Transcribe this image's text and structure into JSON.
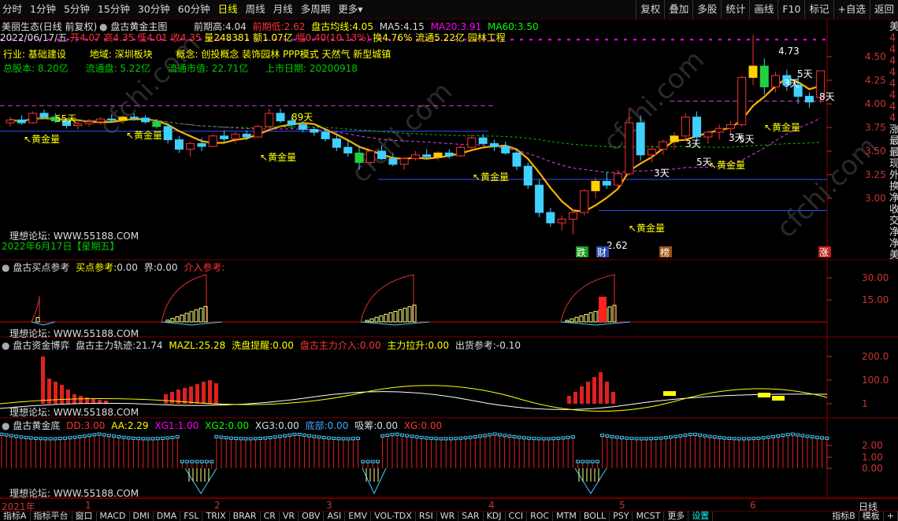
{
  "toolbar": {
    "periods": [
      "分时",
      "1分钟",
      "5分钟",
      "15分钟",
      "30分钟",
      "60分钟",
      "日线",
      "周线",
      "月线",
      "多周期",
      "更多"
    ],
    "active": "日线",
    "more_arrow": "▾",
    "right_buttons": [
      "复权",
      "叠加",
      "多股",
      "统计",
      "画线",
      "F10",
      "标记",
      "+自选",
      "返回"
    ]
  },
  "main": {
    "stock_title": "美丽生态(日线 前复权)",
    "indicator_name": "盘古黄金主图",
    "prev_high_label": "前期高:",
    "prev_high": "4.04",
    "prev_low_label": "前期低:",
    "prev_low": "2.62",
    "pangu_avg_label": "盘古均线:",
    "pangu_avg": "4.05",
    "ma5_label": "MA5:",
    "ma5": "4.15",
    "ma20_label": "MA20:",
    "ma20": "3.91",
    "ma60_label": "MA60:",
    "ma60": "3.50",
    "quote_date": "2022/06/17/五",
    "open_label": "开",
    "open": "4.07",
    "high_label": "高",
    "high": "4.35",
    "low_label": "低",
    "low": "4.01",
    "close_label": "收",
    "close": "4.35",
    "vol_label": "量",
    "vol": "248381",
    "amount_label": "额",
    "amount": "1.07亿",
    "chg_label": "幅",
    "chg": "0.40(10.13%)",
    "turnover_label": "换",
    "turnover": "4.76%",
    "float_label": "流通",
    "float_val": "5.22亿",
    "concept_tail": "园林工程",
    "industry_label": "行业:",
    "industry": "基础建设",
    "region_label": "地域:",
    "region": "深圳板块",
    "concept_label": "概念:",
    "concepts": "创投概念 装饰园林 PPP模式 天然气 新型城镇",
    "total_cap_label": "总股本:",
    "total_cap": "8.20亿",
    "float_cap_label": "流通盘:",
    "float_cap": "5.22亿",
    "float_mv_label": "流通市值:",
    "float_mv": "22.71亿",
    "ipo_label": "上市日期:",
    "ipo": "20200918",
    "forum": "理想论坛: WWW.55188.COM",
    "date_overlay": "2022年6月17日【星期五】",
    "labels": {
      "gold": "黄金量",
      "d55": "55天",
      "d89": "89天",
      "d3": "3天",
      "d5": "5天",
      "d8": "8天",
      "hi": "4.73",
      "lo": "2.62",
      "die": "跌",
      "cai": "财",
      "bang": "榜",
      "zhang": "涨",
      "arrow": "↖"
    },
    "yticks": [
      "4.50",
      "4.25",
      "4.00",
      "3.75",
      "3.50",
      "3.25",
      "3.00"
    ],
    "right_chars": [
      "美",
      "4",
      "4",
      "4",
      "4",
      "4",
      "4",
      "4",
      "4",
      "涨",
      "最",
      "最",
      "现",
      "外",
      "换",
      "净",
      "收",
      "交",
      "净",
      "净",
      "美"
    ],
    "watermark": "cfchi.com"
  },
  "chart_data": {
    "type": "candlestick",
    "price_ylim": [
      2.5,
      4.75
    ],
    "ohlc": [
      [
        3.8,
        3.86,
        3.76,
        3.83
      ],
      [
        3.83,
        3.88,
        3.78,
        3.8
      ],
      [
        3.8,
        3.92,
        3.79,
        3.9
      ],
      [
        3.9,
        3.94,
        3.84,
        3.86
      ],
      [
        3.86,
        3.9,
        3.8,
        3.82
      ],
      [
        3.82,
        3.85,
        3.74,
        3.77
      ],
      [
        3.77,
        3.82,
        3.73,
        3.79
      ],
      [
        3.79,
        3.84,
        3.76,
        3.81
      ],
      [
        3.81,
        3.86,
        3.78,
        3.84
      ],
      [
        3.84,
        3.89,
        3.8,
        3.83
      ],
      [
        3.83,
        3.88,
        3.8,
        3.86
      ],
      [
        3.86,
        3.9,
        3.82,
        3.85
      ],
      [
        3.85,
        3.88,
        3.79,
        3.81
      ],
      [
        3.81,
        3.84,
        3.74,
        3.76
      ],
      [
        3.76,
        3.8,
        3.58,
        3.62
      ],
      [
        3.62,
        3.66,
        3.48,
        3.52
      ],
      [
        3.52,
        3.6,
        3.44,
        3.58
      ],
      [
        3.58,
        3.64,
        3.5,
        3.55
      ],
      [
        3.55,
        3.68,
        3.54,
        3.66
      ],
      [
        3.66,
        3.72,
        3.6,
        3.63
      ],
      [
        3.63,
        3.7,
        3.58,
        3.68
      ],
      [
        3.68,
        3.72,
        3.62,
        3.65
      ],
      [
        3.65,
        3.78,
        3.64,
        3.76
      ],
      [
        3.76,
        3.95,
        3.74,
        3.9
      ],
      [
        3.9,
        3.95,
        3.8,
        3.82
      ],
      [
        3.82,
        3.88,
        3.74,
        3.78
      ],
      [
        3.78,
        3.82,
        3.7,
        3.73
      ],
      [
        3.73,
        3.76,
        3.66,
        3.7
      ],
      [
        3.7,
        3.74,
        3.6,
        3.63
      ],
      [
        3.63,
        3.68,
        3.5,
        3.54
      ],
      [
        3.54,
        3.62,
        3.44,
        3.48
      ],
      [
        3.48,
        3.56,
        3.3,
        3.38
      ],
      [
        3.38,
        3.52,
        3.36,
        3.5
      ],
      [
        3.5,
        3.56,
        3.4,
        3.42
      ],
      [
        3.42,
        3.48,
        3.34,
        3.36
      ],
      [
        3.36,
        3.44,
        3.3,
        3.42
      ],
      [
        3.42,
        3.5,
        3.4,
        3.46
      ],
      [
        3.46,
        3.52,
        3.42,
        3.44
      ],
      [
        3.44,
        3.5,
        3.4,
        3.48
      ],
      [
        3.48,
        3.52,
        3.42,
        3.45
      ],
      [
        3.45,
        3.56,
        3.44,
        3.54
      ],
      [
        3.54,
        3.68,
        3.52,
        3.64
      ],
      [
        3.64,
        3.68,
        3.56,
        3.58
      ],
      [
        3.58,
        3.62,
        3.5,
        3.55
      ],
      [
        3.55,
        3.6,
        3.46,
        3.48
      ],
      [
        3.48,
        3.52,
        3.3,
        3.34
      ],
      [
        3.34,
        3.38,
        3.1,
        3.14
      ],
      [
        3.14,
        3.2,
        2.8,
        2.85
      ],
      [
        2.85,
        2.9,
        2.7,
        2.74
      ],
      [
        2.74,
        2.82,
        2.66,
        2.78
      ],
      [
        2.78,
        2.88,
        2.62,
        2.85
      ],
      [
        2.85,
        3.1,
        2.82,
        3.08
      ],
      [
        3.08,
        3.22,
        3.0,
        3.18
      ],
      [
        3.18,
        3.28,
        3.1,
        3.14
      ],
      [
        3.14,
        3.3,
        3.12,
        3.26
      ],
      [
        3.26,
        3.96,
        3.24,
        3.8
      ],
      [
        3.8,
        3.88,
        3.4,
        3.46
      ],
      [
        3.46,
        3.56,
        3.38,
        3.52
      ],
      [
        3.52,
        3.62,
        3.46,
        3.6
      ],
      [
        3.6,
        3.7,
        3.52,
        3.66
      ],
      [
        3.66,
        3.9,
        3.62,
        3.86
      ],
      [
        3.86,
        3.92,
        3.6,
        3.65
      ],
      [
        3.65,
        3.72,
        3.58,
        3.7
      ],
      [
        3.7,
        3.78,
        3.62,
        3.74
      ],
      [
        3.74,
        3.82,
        3.66,
        3.78
      ],
      [
        3.78,
        4.3,
        3.76,
        4.28
      ],
      [
        4.28,
        4.73,
        4.2,
        4.4
      ],
      [
        4.4,
        4.48,
        4.1,
        4.18
      ],
      [
        4.18,
        4.34,
        4.12,
        4.3
      ],
      [
        4.3,
        4.36,
        4.14,
        4.2
      ],
      [
        4.2,
        4.3,
        4.0,
        4.08
      ],
      [
        4.08,
        4.12,
        3.96,
        4.02
      ],
      [
        4.07,
        4.35,
        4.01,
        4.35
      ]
    ],
    "buy_series": [
      0,
      0,
      0,
      0,
      0,
      0,
      0,
      0,
      0,
      0,
      0,
      0,
      0,
      0,
      0,
      0,
      0,
      0,
      0,
      0,
      0,
      0,
      0,
      0,
      0,
      0,
      0,
      0,
      0,
      0,
      0,
      0,
      0,
      0,
      0,
      0,
      0,
      0,
      0,
      0,
      0,
      0,
      0,
      0,
      0,
      0,
      0,
      0,
      0,
      0,
      0,
      0,
      0,
      0,
      0,
      0,
      0,
      0,
      0,
      0,
      0,
      0,
      0,
      0,
      0,
      0,
      0,
      0,
      0,
      0,
      0,
      0,
      0
    ],
    "buy_ref": {
      "buy_ref": "0.00",
      "jie": "0.00"
    },
    "zhuli_track": "21.74",
    "mazl": "25.28",
    "xipan": "0.00",
    "zhuli_jieru": "0.00",
    "zhuli_lasheng": "0.00",
    "chuhuo": "-0.10",
    "huangjin_di": {
      "dd": "3.00",
      "aa": "2.29",
      "xg1": "1.00",
      "xg2": "0.00",
      "xg3": "0.00",
      "dibu": "0.00",
      "xichou": "0.00",
      "xg": "0.00"
    }
  },
  "sub1": {
    "title": "盘古买点参考",
    "buy_label": "买点参考:",
    "buy_val": "0.00",
    "jie_label": "界:",
    "jie_val": "0.00",
    "jieru_label": "介入参考:",
    "yticks": [
      "30.00",
      "15.00"
    ],
    "forum": "理想论坛: WWW.55188.COM"
  },
  "sub2": {
    "title": "盘古资金博弈",
    "track_label": "盘古主力轨迹:",
    "track_val": "21.74",
    "mazl_label": "MAZL:",
    "mazl_val": "25.28",
    "xipan_label": "洗盘提醒:",
    "xipan_val": "0.00",
    "jieru_label": "盘古主力介入:",
    "jieru_val": "0.00",
    "lasheng_label": "主力拉升:",
    "lasheng_val": "0.00",
    "chuhuo_label": "出货参考:",
    "chuhuo_val": "-0.10",
    "yticks": [
      "200.0",
      "100.0",
      "1"
    ],
    "forum": "理想论坛: WWW.55188.COM"
  },
  "sub3": {
    "title": "盘古黄金底",
    "dd_label": "DD:",
    "dd_val": "3.00",
    "aa_label": "AA:",
    "aa_val": "2.29",
    "xg1_label": "XG1:",
    "xg1_val": "1.00",
    "xg2_label": "XG2:",
    "xg2_val": "0.00",
    "xg3_label": "XG3:",
    "xg3_val": "0.00",
    "dibu_label": "底部:",
    "dibu_val": "0.00",
    "xichou_label": "吸筹:",
    "xichou_val": "0.00",
    "xg_label": "XG:",
    "xg_val": "0.00",
    "yticks": [
      "2.00",
      "1.00",
      "0.00"
    ],
    "forum": "理想论坛: WWW.55188.COM"
  },
  "axis": {
    "year": "2021年",
    "months": [
      "1",
      "2",
      "3",
      "4",
      "5",
      "6"
    ]
  },
  "bottom_tabs": [
    "指标A",
    "指标平台",
    "窗口",
    "MACD",
    "DMI",
    "DMA",
    "FSL",
    "TRIX",
    "BRAR",
    "CR",
    "VR",
    "OBV",
    "ASI",
    "EMV",
    "VOL-TDX",
    "RSI",
    "WR",
    "SAR",
    "KDJ",
    "CCI",
    "ROC",
    "MTM",
    "BOLL",
    "PSY",
    "MCST",
    "更多",
    "设置"
  ],
  "bottom_right": [
    "指标B",
    "模板",
    "+"
  ],
  "period_corner": "日线"
}
